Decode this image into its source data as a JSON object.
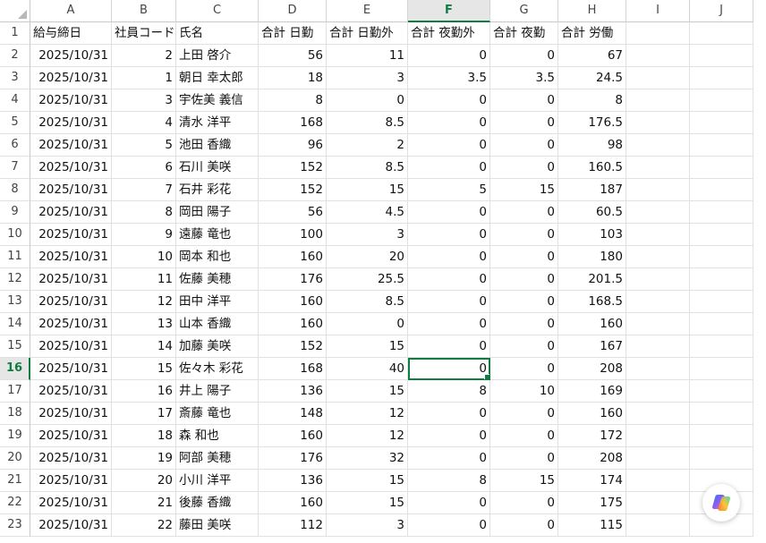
{
  "columns": [
    "A",
    "B",
    "C",
    "D",
    "E",
    "F",
    "G",
    "H",
    "I",
    "J"
  ],
  "active_column": "F",
  "active_row": 16,
  "header_row": {
    "A": "給与締日",
    "B": "社員コード",
    "C": "氏名",
    "D": "合計 日勤",
    "E": "合計 日勤外",
    "F": "合計 夜勤外",
    "G": "合計 夜勤",
    "H": "合計 労働"
  },
  "rows": [
    {
      "r": "2",
      "date": "2025/10/31",
      "code": "2",
      "name": "上田 啓介",
      "d": "56",
      "e": "11",
      "f": "0",
      "g": "0",
      "h": "67"
    },
    {
      "r": "3",
      "date": "2025/10/31",
      "code": "1",
      "name": "朝日 幸太郎",
      "d": "18",
      "e": "3",
      "f": "3.5",
      "g": "3.5",
      "h": "24.5"
    },
    {
      "r": "4",
      "date": "2025/10/31",
      "code": "3",
      "name": "宇佐美 義信",
      "d": "8",
      "e": "0",
      "f": "0",
      "g": "0",
      "h": "8"
    },
    {
      "r": "5",
      "date": "2025/10/31",
      "code": "4",
      "name": "清水 洋平",
      "d": "168",
      "e": "8.5",
      "f": "0",
      "g": "0",
      "h": "176.5"
    },
    {
      "r": "6",
      "date": "2025/10/31",
      "code": "5",
      "name": "池田 香織",
      "d": "96",
      "e": "2",
      "f": "0",
      "g": "0",
      "h": "98"
    },
    {
      "r": "7",
      "date": "2025/10/31",
      "code": "6",
      "name": "石川 美咲",
      "d": "152",
      "e": "8.5",
      "f": "0",
      "g": "0",
      "h": "160.5"
    },
    {
      "r": "8",
      "date": "2025/10/31",
      "code": "7",
      "name": "石井 彩花",
      "d": "152",
      "e": "15",
      "f": "5",
      "g": "15",
      "h": "187"
    },
    {
      "r": "9",
      "date": "2025/10/31",
      "code": "8",
      "name": "岡田 陽子",
      "d": "56",
      "e": "4.5",
      "f": "0",
      "g": "0",
      "h": "60.5"
    },
    {
      "r": "10",
      "date": "2025/10/31",
      "code": "9",
      "name": "遠藤 竜也",
      "d": "100",
      "e": "3",
      "f": "0",
      "g": "0",
      "h": "103"
    },
    {
      "r": "11",
      "date": "2025/10/31",
      "code": "10",
      "name": "岡本 和也",
      "d": "160",
      "e": "20",
      "f": "0",
      "g": "0",
      "h": "180"
    },
    {
      "r": "12",
      "date": "2025/10/31",
      "code": "11",
      "name": "佐藤 美穂",
      "d": "176",
      "e": "25.5",
      "f": "0",
      "g": "0",
      "h": "201.5"
    },
    {
      "r": "13",
      "date": "2025/10/31",
      "code": "12",
      "name": "田中 洋平",
      "d": "160",
      "e": "8.5",
      "f": "0",
      "g": "0",
      "h": "168.5"
    },
    {
      "r": "14",
      "date": "2025/10/31",
      "code": "13",
      "name": "山本 香織",
      "d": "160",
      "e": "0",
      "f": "0",
      "g": "0",
      "h": "160"
    },
    {
      "r": "15",
      "date": "2025/10/31",
      "code": "14",
      "name": "加藤 美咲",
      "d": "152",
      "e": "15",
      "f": "0",
      "g": "0",
      "h": "167"
    },
    {
      "r": "16",
      "date": "2025/10/31",
      "code": "15",
      "name": "佐々木 彩花",
      "d": "168",
      "e": "40",
      "f": "0",
      "g": "0",
      "h": "208"
    },
    {
      "r": "17",
      "date": "2025/10/31",
      "code": "16",
      "name": "井上 陽子",
      "d": "136",
      "e": "15",
      "f": "8",
      "g": "10",
      "h": "169"
    },
    {
      "r": "18",
      "date": "2025/10/31",
      "code": "17",
      "name": "斎藤 竜也",
      "d": "148",
      "e": "12",
      "f": "0",
      "g": "0",
      "h": "160"
    },
    {
      "r": "19",
      "date": "2025/10/31",
      "code": "18",
      "name": "森 和也",
      "d": "160",
      "e": "12",
      "f": "0",
      "g": "0",
      "h": "172"
    },
    {
      "r": "20",
      "date": "2025/10/31",
      "code": "19",
      "name": "阿部 美穂",
      "d": "176",
      "e": "32",
      "f": "0",
      "g": "0",
      "h": "208"
    },
    {
      "r": "21",
      "date": "2025/10/31",
      "code": "20",
      "name": "小川 洋平",
      "d": "136",
      "e": "15",
      "f": "8",
      "g": "15",
      "h": "174"
    },
    {
      "r": "22",
      "date": "2025/10/31",
      "code": "21",
      "name": "後藤 香織",
      "d": "160",
      "e": "15",
      "f": "0",
      "g": "0",
      "h": "175"
    },
    {
      "r": "23",
      "date": "2025/10/31",
      "code": "22",
      "name": "藤田 美咲",
      "d": "112",
      "e": "3",
      "f": "0",
      "g": "0",
      "h": "115"
    }
  ],
  "copilot_icon": "copilot-icon",
  "colors": {
    "accent": "#107c41",
    "grid": "#e1e1e1"
  }
}
